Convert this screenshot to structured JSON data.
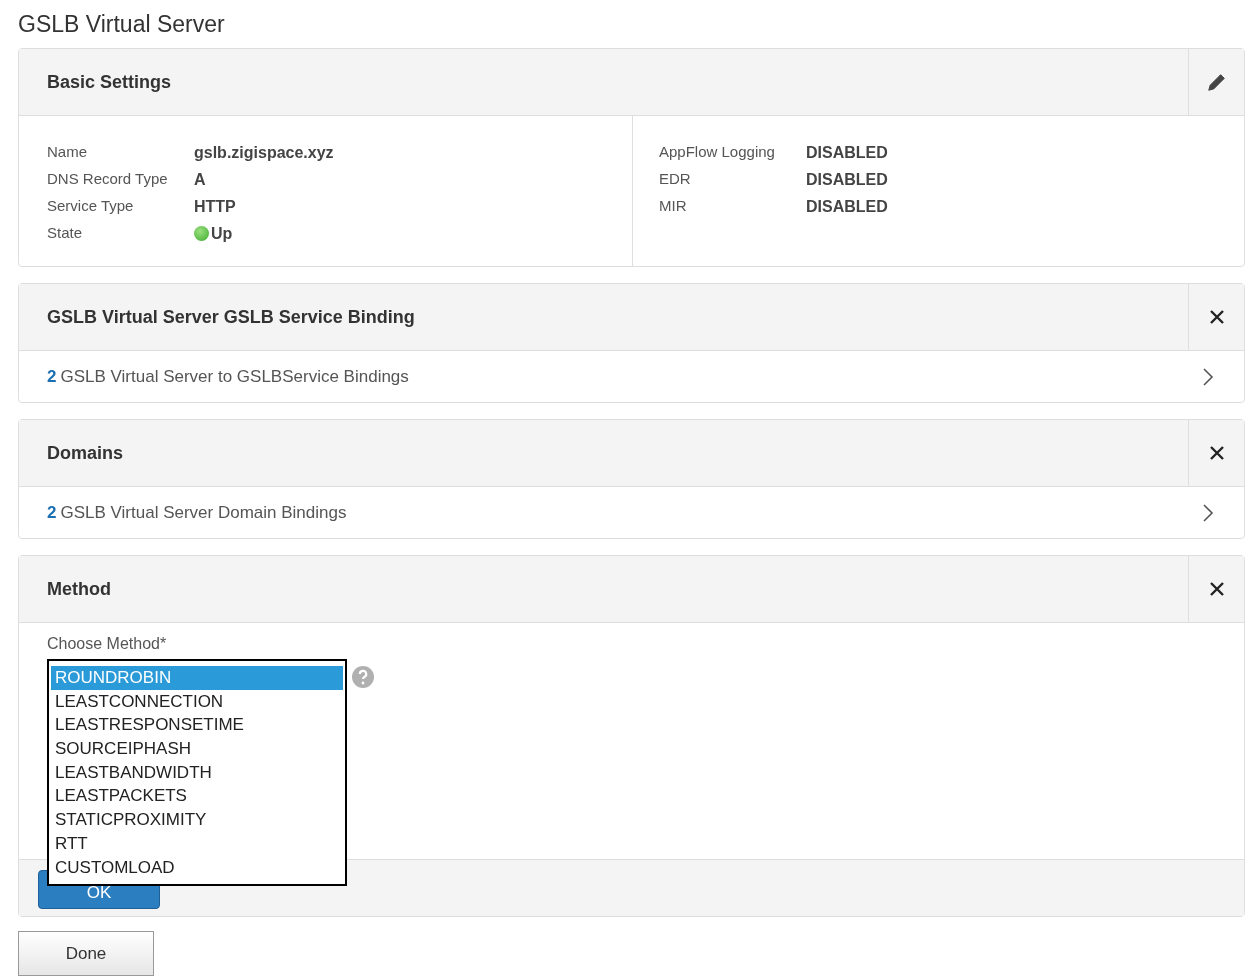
{
  "page_title": "GSLB Virtual Server",
  "basic_settings": {
    "title": "Basic Settings",
    "kind": "edit",
    "left": [
      {
        "label": "Name",
        "value": "gslb.zigispace.xyz",
        "kind": "text"
      },
      {
        "label": "DNS Record Type",
        "value": "A",
        "kind": "text"
      },
      {
        "label": "Service Type",
        "value": "HTTP",
        "kind": "text"
      },
      {
        "label": "State",
        "value": "Up",
        "kind": "status"
      }
    ],
    "right": [
      {
        "label": "AppFlow Logging",
        "value": "DISABLED",
        "kind": "text"
      },
      {
        "label": "EDR",
        "value": "DISABLED",
        "kind": "text"
      },
      {
        "label": "MIR",
        "value": "DISABLED",
        "kind": "text"
      }
    ]
  },
  "sections": [
    {
      "title": "GSLB Virtual Server GSLB Service Binding",
      "kind": "close",
      "count": "2",
      "link": "GSLB Virtual Server to GSLBService Bindings"
    },
    {
      "title": "Domains",
      "kind": "close",
      "count": "2",
      "link": "GSLB Virtual Server Domain Bindings"
    }
  ],
  "method": {
    "title": "Method",
    "kind": "close",
    "label": "Choose Method*",
    "options": [
      {
        "label": "ROUNDROBIN",
        "selected": true
      },
      {
        "label": "LEASTCONNECTION",
        "selected": false
      },
      {
        "label": "LEASTRESPONSETIME",
        "selected": false
      },
      {
        "label": "SOURCEIPHASH",
        "selected": false
      },
      {
        "label": "LEASTBANDWIDTH",
        "selected": false
      },
      {
        "label": "LEASTPACKETS",
        "selected": false
      },
      {
        "label": "STATICPROXIMITY",
        "selected": false
      },
      {
        "label": "RTT",
        "selected": false
      },
      {
        "label": "CUSTOMLOAD",
        "selected": false
      }
    ],
    "ok_button": "OK"
  },
  "done_button": "Done"
}
